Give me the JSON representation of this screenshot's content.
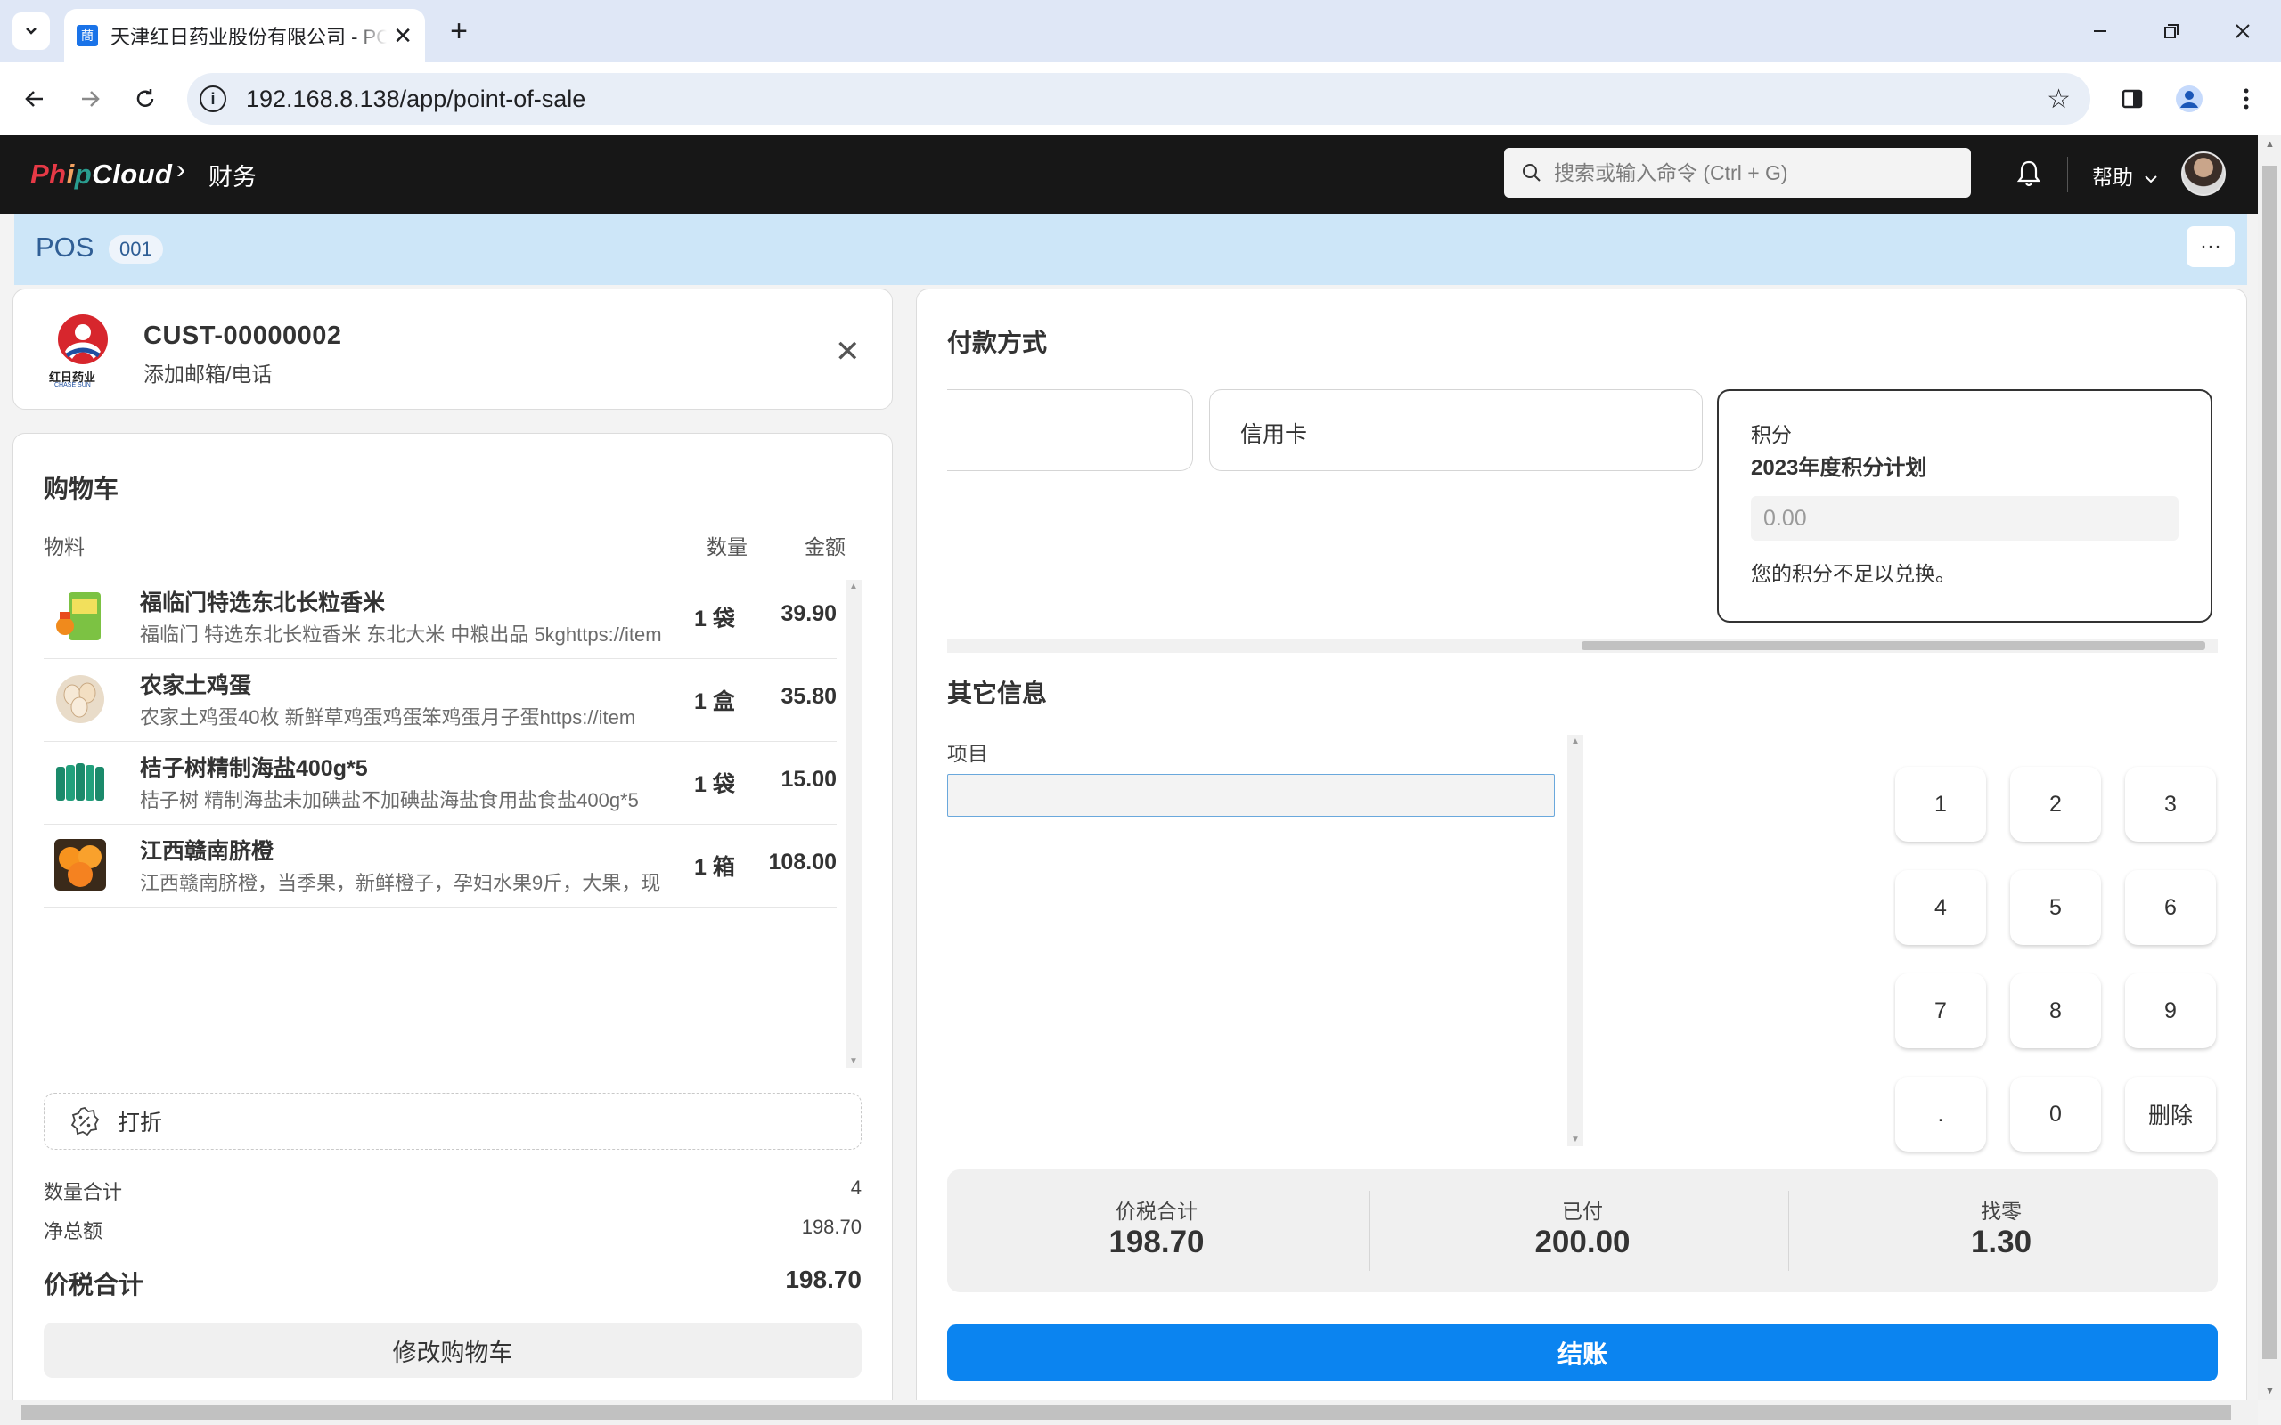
{
  "browser": {
    "tab_title": "天津红日药业股份有限公司 - POS",
    "tab_favicon": "蕳",
    "url": "192.168.8.138/app/point-of-sale"
  },
  "navbar": {
    "logo": {
      "p1": "Ph",
      "p2": "i",
      "p3": "p",
      "p4": "Cloud"
    },
    "breadcrumb": "财务",
    "search_placeholder": "搜索或输入命令 (Ctrl + G)",
    "help_label": "帮助"
  },
  "page": {
    "title": "POS",
    "badge": "001",
    "more_label": "···"
  },
  "customer": {
    "name": "CUST-00000002",
    "subtitle": "添加邮箱/电话",
    "logo_text": "红日药业",
    "logo_sub": "CHASE SUN"
  },
  "cart": {
    "title": "购物车",
    "col_item": "物料",
    "col_qty": "数量",
    "col_amount": "金额",
    "items": [
      {
        "name": "福临门特选东北长粒香米",
        "desc": "福临门 特选东北长粒香米 东北大米 中粮出品 5kghttps://item",
        "qty": "1 袋",
        "amount": "39.90"
      },
      {
        "name": "农家土鸡蛋",
        "desc": "农家土鸡蛋40枚 新鲜草鸡蛋鸡蛋笨鸡蛋月子蛋https://item",
        "qty": "1 盒",
        "amount": "35.80"
      },
      {
        "name": "桔子树精制海盐400g*5",
        "desc": "桔子树 精制海盐未加碘盐不加碘盐海盐食用盐食盐400g*5",
        "qty": "1 袋",
        "amount": "15.00"
      },
      {
        "name": "江西赣南脐橙",
        "desc": "江西赣南脐橙，当季果，新鲜橙子，孕妇水果9斤，大果，现",
        "qty": "1 箱",
        "amount": "108.00"
      }
    ],
    "discount_label": "打折",
    "total_qty_label": "数量合计",
    "total_qty": "4",
    "net_total_label": "净总额",
    "net_total": "198.70",
    "grand_total_label": "价税合计",
    "grand_total": "198.70",
    "edit_label": "修改购物车"
  },
  "payment": {
    "title": "付款方式",
    "methods": {
      "credit_card": "信用卡",
      "points_label": "积分",
      "points_plan": "2023年度积分计划",
      "points_value": "0.00",
      "points_msg": "您的积分不足以兑换。"
    },
    "other_title": "其它信息",
    "project_label": "项目",
    "keypad": [
      "1",
      "2",
      "3",
      "4",
      "5",
      "6",
      "7",
      "8",
      "9",
      ".",
      "0",
      "删除"
    ],
    "totals": [
      {
        "label": "价税合计",
        "value": "198.70"
      },
      {
        "label": "已付",
        "value": "200.00"
      },
      {
        "label": "找零",
        "value": "1.30"
      }
    ],
    "checkout_label": "结账"
  },
  "colors": {
    "navbar_bg": "#171717",
    "pagehead_bg": "#cde6f8",
    "primary": "#0b84f0"
  }
}
